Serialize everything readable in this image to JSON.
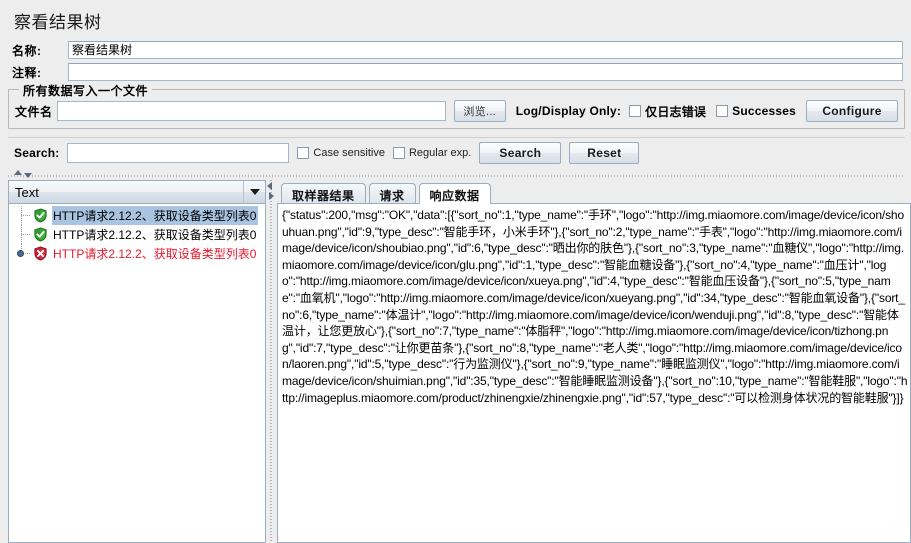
{
  "window": {
    "panel_title": "察看结果树"
  },
  "form": {
    "name_label": "名称:",
    "name_value": "察看结果树",
    "comment_label": "注释:",
    "comment_value": ""
  },
  "filegroup": {
    "title": "所有数据写入一个文件",
    "filename_label": "文件名",
    "filename_value": "",
    "browse_label": "浏览...",
    "logdisplay_label": "Log/Display Only:",
    "errors_only_label": "仅日志错误",
    "errors_only_checked": false,
    "successes_label": "Successes",
    "successes_checked": false,
    "configure_label": "Configure"
  },
  "search": {
    "label": "Search:",
    "value": "",
    "case_sensitive_label": "Case sensitive",
    "case_sensitive_checked": false,
    "regular_exp_label": "Regular exp.",
    "regular_exp_checked": false,
    "search_button": "Search",
    "reset_button": "Reset"
  },
  "left": {
    "render_combo_value": "Text",
    "tree_nodes": [
      {
        "label": "HTTP请求2.12.2、获取设备类型列表0",
        "status": "success",
        "selected": true
      },
      {
        "label": "HTTP请求2.12.2、获取设备类型列表0",
        "status": "success",
        "selected": false
      },
      {
        "label": "HTTP请求2.12.2、获取设备类型列表0",
        "status": "error",
        "selected": false
      }
    ]
  },
  "right": {
    "tabs": [
      {
        "label": "取样器结果",
        "active": false
      },
      {
        "label": "请求",
        "active": false
      },
      {
        "label": "响应数据",
        "active": true
      }
    ],
    "response_text": "{\"status\":200,\"msg\":\"OK\",\"data\":[{\"sort_no\":1,\"type_name\":\"手环\",\"logo\":\"http://img.miaomore.com/image/device/icon/shouhuan.png\",\"id\":9,\"type_desc\":\"智能手环，小米手环\"},{\"sort_no\":2,\"type_name\":\"手表\",\"logo\":\"http://img.miaomore.com/image/device/icon/shoubiao.png\",\"id\":6,\"type_desc\":\"晒出你的肤色\"},{\"sort_no\":3,\"type_name\":\"血糖仪\",\"logo\":\"http://img.miaomore.com/image/device/icon/glu.png\",\"id\":1,\"type_desc\":\"智能血糖设备\"},{\"sort_no\":4,\"type_name\":\"血压计\",\"logo\":\"http://img.miaomore.com/image/device/icon/xueya.png\",\"id\":4,\"type_desc\":\"智能血压设备\"},{\"sort_no\":5,\"type_name\":\"血氧机\",\"logo\":\"http://img.miaomore.com/image/device/icon/xueyang.png\",\"id\":34,\"type_desc\":\"智能血氧设备\"},{\"sort_no\":6,\"type_name\":\"体温计\",\"logo\":\"http://img.miaomore.com/image/device/icon/wenduji.png\",\"id\":8,\"type_desc\":\"智能体温计，让您更放心\"},{\"sort_no\":7,\"type_name\":\"体脂秤\",\"logo\":\"http://img.miaomore.com/image/device/icon/tizhong.png\",\"id\":7,\"type_desc\":\"让你更苗条\"},{\"sort_no\":8,\"type_name\":\"老人类\",\"logo\":\"http://img.miaomore.com/image/device/icon/laoren.png\",\"id\":5,\"type_desc\":\"行为监测仪\"},{\"sort_no\":9,\"type_name\":\"睡眠监测仪\",\"logo\":\"http://img.miaomore.com/image/device/icon/shuimian.png\",\"id\":35,\"type_desc\":\"智能睡眠监测设备\"},{\"sort_no\":10,\"type_name\":\"智能鞋服\",\"logo\":\"http://imageplus.miaomore.com/product/zhinengxie/zhinengxie.png\",\"id\":57,\"type_desc\":\"可以检测身体状况的智能鞋服\"}]}"
  },
  "colors": {
    "success_green": "#2f9e2f",
    "error_red": "#c9202f",
    "selection_blue": "#a8c4e0",
    "panel_bg": "#ededed"
  }
}
